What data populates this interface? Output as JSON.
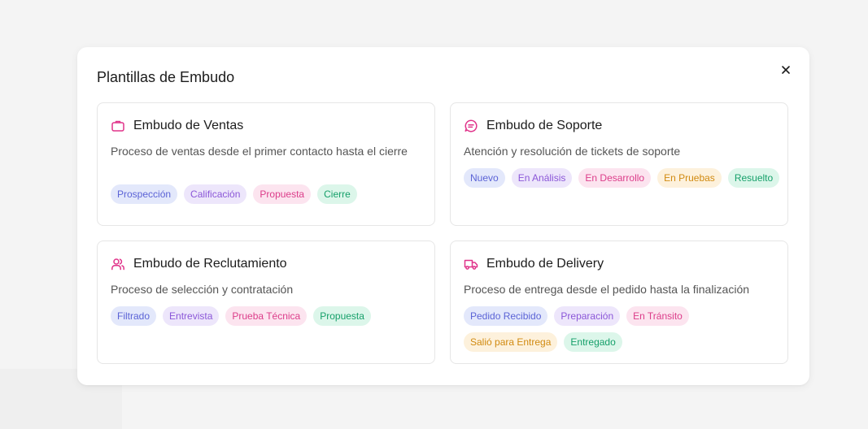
{
  "modal": {
    "title": "Plantillas de Embudo",
    "close_icon": "close-icon"
  },
  "accent_color": "#e0338a",
  "templates": [
    {
      "title": "Embudo de Ventas",
      "icon": "briefcase-icon",
      "description": "Proceso de ventas desde el primer contacto hasta el cierre",
      "stages": [
        "Prospección",
        "Calificación",
        "Propuesta",
        "Cierre"
      ]
    },
    {
      "title": "Embudo de Soporte",
      "icon": "message-circle-icon",
      "description": "Atención y resolución de tickets de soporte",
      "stages": [
        "Nuevo",
        "En Análisis",
        "En Desarrollo",
        "En Pruebas",
        "Resuelto"
      ]
    },
    {
      "title": "Embudo de Reclutamiento",
      "icon": "users-icon",
      "description": "Proceso de selección y contratación",
      "stages": [
        "Filtrado",
        "Entrevista",
        "Prueba Técnica",
        "Propuesta"
      ]
    },
    {
      "title": "Embudo de Delivery",
      "icon": "truck-icon",
      "description": "Proceso de entrega desde el pedido hasta la finalización",
      "stages": [
        "Pedido Recibido",
        "Preparación",
        "En Tránsito",
        "Salió para Entrega",
        "Entregado"
      ]
    }
  ]
}
